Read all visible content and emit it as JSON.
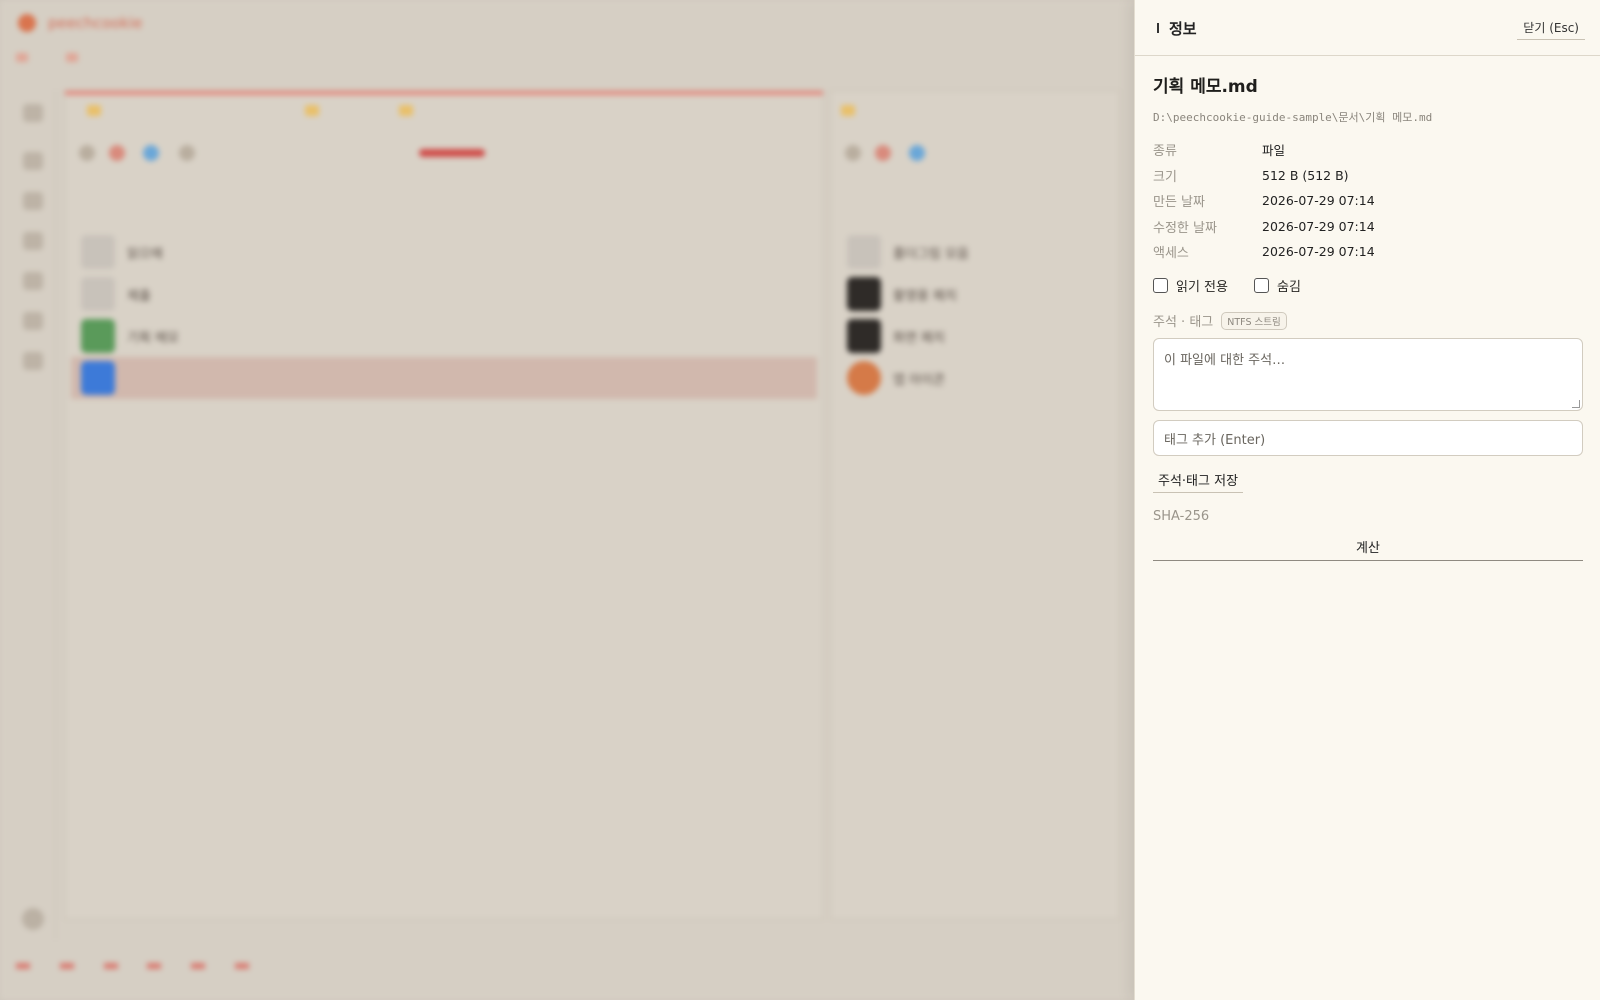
{
  "panel": {
    "header_title": "정보",
    "close_label": "닫기 (Esc)",
    "file_title": "기획 메모.md",
    "file_path": "D:\\peechcookie-guide-sample\\문서\\기획 메모.md",
    "rows": [
      {
        "key": "종류",
        "value": "파일"
      },
      {
        "key": "크기",
        "value": "512 B (512 B)"
      },
      {
        "key": "만든 날짜",
        "value": "2026-07-29 07:14"
      },
      {
        "key": "수정한 날짜",
        "value": "2026-07-29 07:14"
      },
      {
        "key": "액세스",
        "value": "2026-07-29 07:14"
      }
    ],
    "readonly_label": "읽기 전용",
    "hidden_label": "숨김",
    "readonly_checked": false,
    "hidden_checked": false,
    "annotation_label": "주석 · 태그",
    "ntfs_badge": "NTFS 스트림",
    "annotation_placeholder": "이 파일에 대한 주석…",
    "tag_placeholder": "태그 추가 (Enter)",
    "save_label": "주석·태그 저장",
    "sha_label": "SHA-256",
    "calc_label": "계산"
  },
  "background": {
    "brand": "peechcookie",
    "left_rows": [
      "읽으매",
      "제출",
      "기획 메모"
    ],
    "right_rows": [
      "폴더그림 모음",
      "촬영용 패치",
      "화면 패치",
      "앱 아이콘"
    ]
  }
}
